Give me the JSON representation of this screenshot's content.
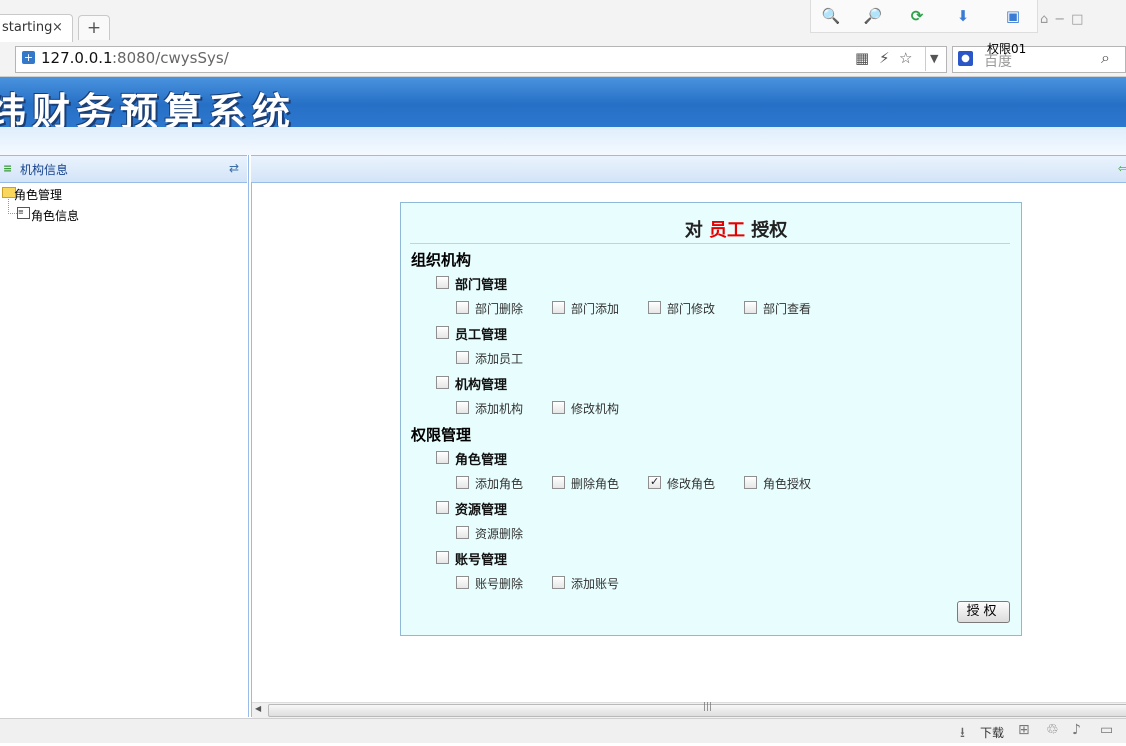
{
  "browser": {
    "tab_title": "starting",
    "tab_close": "×",
    "new_tab": "+",
    "url_host": "127.0.0.1",
    "url_rest": ":8080/cwysSys/",
    "search_engine": "百度",
    "user_label": "权限01",
    "tools": [
      "zoom-in-icon",
      "zoom-out-icon",
      "refresh-icon",
      "download-tool-icon",
      "screen-icon"
    ]
  },
  "app": {
    "title": "纬财务预算系统"
  },
  "left_panel": {
    "title": "机构信息",
    "tree": {
      "folder": "角色管理",
      "leaf": "角色信息"
    }
  },
  "form": {
    "title_prefix": "对",
    "title_role": "员工",
    "title_suffix": "授权",
    "sections": [
      {
        "name": "组织机构",
        "groups": [
          {
            "name": "部门管理",
            "checked": false,
            "perms": [
              {
                "label": "部门删除",
                "checked": false
              },
              {
                "label": "部门添加",
                "checked": false
              },
              {
                "label": "部门修改",
                "checked": false
              },
              {
                "label": "部门查看",
                "checked": false
              }
            ]
          },
          {
            "name": "员工管理",
            "checked": false,
            "perms": [
              {
                "label": "添加员工",
                "checked": false
              }
            ]
          },
          {
            "name": "机构管理",
            "checked": false,
            "perms": [
              {
                "label": "添加机构",
                "checked": false
              },
              {
                "label": "修改机构",
                "checked": false
              }
            ]
          }
        ]
      },
      {
        "name": "权限管理",
        "groups": [
          {
            "name": "角色管理",
            "checked": false,
            "perms": [
              {
                "label": "添加角色",
                "checked": false
              },
              {
                "label": "删除角色",
                "checked": false
              },
              {
                "label": "修改角色",
                "checked": true
              },
              {
                "label": "角色授权",
                "checked": false
              }
            ]
          },
          {
            "name": "资源管理",
            "checked": false,
            "perms": [
              {
                "label": "资源删除",
                "checked": false
              }
            ]
          },
          {
            "name": "账号管理",
            "checked": false,
            "perms": [
              {
                "label": "账号删除",
                "checked": false
              },
              {
                "label": "添加账号",
                "checked": false
              }
            ]
          }
        ]
      }
    ],
    "submit_label": "授权"
  },
  "statusbar": {
    "download_label": "下载"
  }
}
